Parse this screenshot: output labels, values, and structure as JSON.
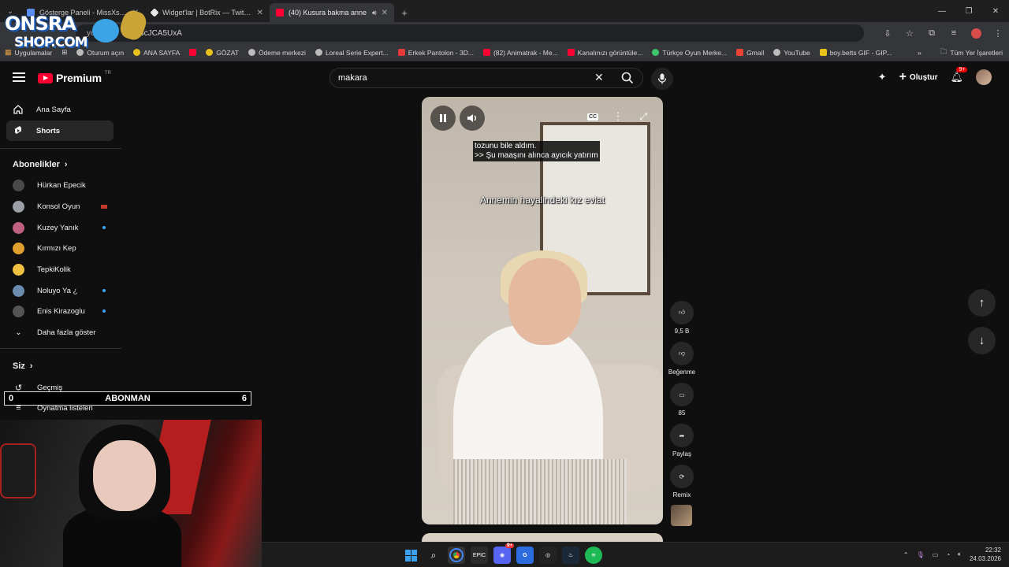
{
  "browser": {
    "tabs": [
      {
        "title": "Gösterge Paneli - MissXss AI Bo",
        "color": "#5b8def",
        "active": false
      },
      {
        "title": "Widget'lar | BotRix — Twitch, K",
        "color": "#e8e8e8",
        "active": false
      },
      {
        "title": "(40) Kusura bakma anne",
        "color": "#ff0033",
        "active": true
      }
    ],
    "url_fragment": "/5F3cJCA5UxA",
    "url_prefix": "yo",
    "bookmarks": [
      {
        "label": "Uygulamalar",
        "color": "#888888"
      },
      {
        "label": "",
        "color": "#ff0033"
      },
      {
        "label": "Oturum açın",
        "color": "#bbbbbb"
      },
      {
        "label": "ANA SAYFA",
        "color": "#e8c21a"
      },
      {
        "label": "",
        "color": "#ff0033"
      },
      {
        "label": "GÖZAT",
        "color": "#e8c21a"
      },
      {
        "label": "Ödeme merkezi",
        "color": "#bbbbbb"
      },
      {
        "label": "Loreal Serie Expert...",
        "color": "#bbbbbb"
      },
      {
        "label": "Erkek Pantolon - 3D...",
        "color": "#e33a3a"
      },
      {
        "label": "(82) Animatrak - Me...",
        "color": "#ff0033"
      },
      {
        "label": "Kanalınızı görüntüle...",
        "color": "#ff0033"
      },
      {
        "label": "Türkçe Oyun Merke...",
        "color": "#3ec46d"
      },
      {
        "label": "Gmail",
        "color": "#ea4335"
      },
      {
        "label": "YouTube",
        "color": "#bbbbbb"
      },
      {
        "label": "boy.betts GIF - GIP...",
        "color": "#e8c21a"
      }
    ],
    "all_bookmarks": "Tüm Yer İşaretleri"
  },
  "logo": {
    "line1": "ONSRA",
    "line2": "SHOP.COM"
  },
  "header": {
    "brand": "Premium",
    "region": "TR",
    "search_value": "makara",
    "create_label": "Oluştur",
    "notif_badge": "9+"
  },
  "sidebar": {
    "home": "Ana Sayfa",
    "shorts": "Shorts",
    "subs_heading": "Abonelikler",
    "subscriptions": [
      {
        "name": "Hürkan Epecik",
        "color": "#4a4a4a",
        "marker": ""
      },
      {
        "name": "Konsol Oyun",
        "color": "#9aa0a6",
        "marker": "live"
      },
      {
        "name": "Kuzey Yanık",
        "color": "#c06080",
        "marker": "new"
      },
      {
        "name": "Kırmızı Kep",
        "color": "#e0a030",
        "marker": ""
      },
      {
        "name": "TepkiKolik",
        "color": "#f0c040",
        "marker": ""
      },
      {
        "name": "Noluyo Ya ¿",
        "color": "#6b8cae",
        "marker": "new"
      },
      {
        "name": "Enis Kirazoglu",
        "color": "#555555",
        "marker": "new"
      }
    ],
    "show_more": "Daha fazla göster",
    "you_heading": "Siz",
    "history": "Geçmiş",
    "playlists": "Oynatma listeleri"
  },
  "abonman": {
    "left": "0",
    "label": "ABONMAN",
    "right": "6"
  },
  "player": {
    "caption_line1": "tozunu bile aldım.",
    "caption_line2": ">> Şu maaşını alınca ayıcık yatırım",
    "overlay": "Annemin hayalindeki kız evlat"
  },
  "actions": {
    "likes": "9,5 B",
    "dislike_label": "Beğenme",
    "comments": "85",
    "share_label": "Paylaş",
    "remix_label": "Remix"
  },
  "taskbar": {
    "time": "22:32",
    "date": "24.03.2026",
    "discord_badge": "9+"
  }
}
